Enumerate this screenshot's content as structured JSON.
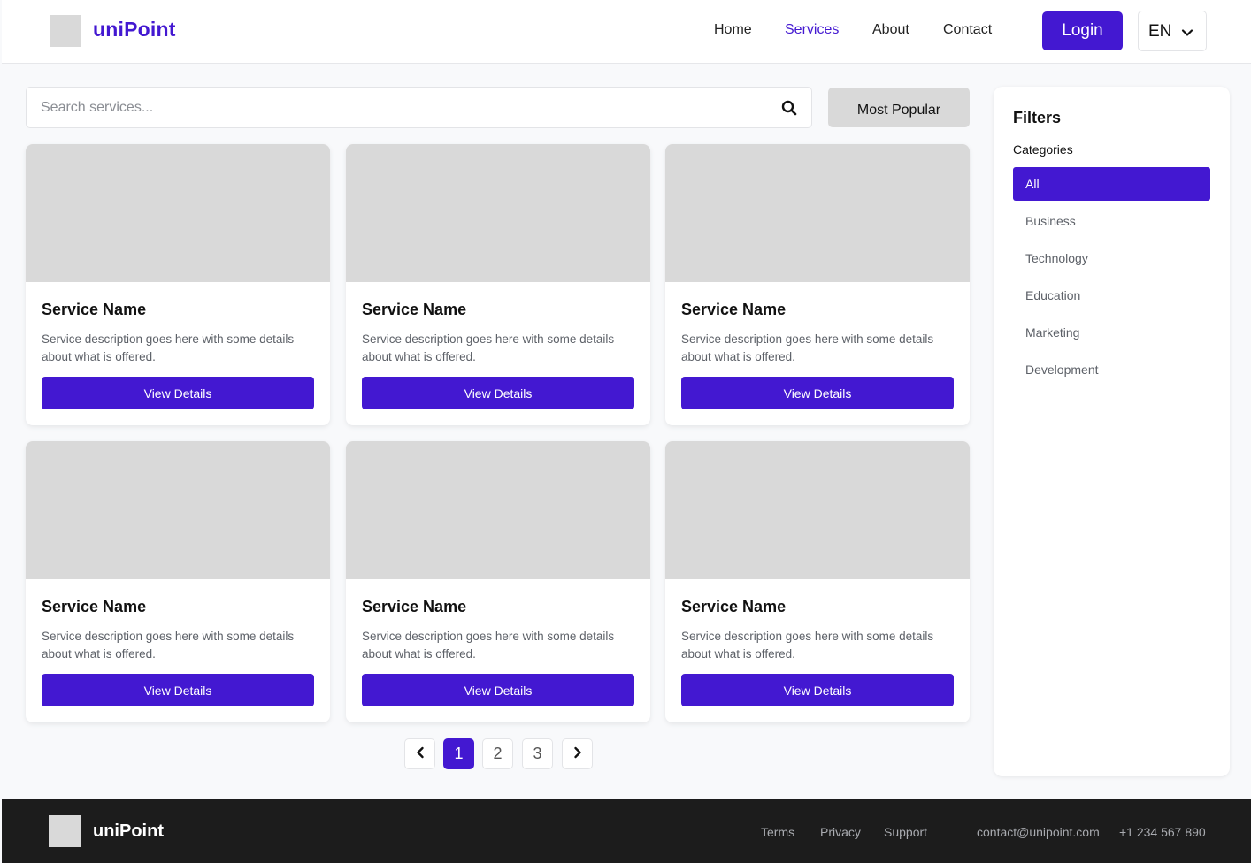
{
  "brand": {
    "name": "uniPoint",
    "accent": "#4318d1"
  },
  "header": {
    "nav": [
      "Home",
      "Services",
      "About",
      "Contact"
    ],
    "active_nav": "Services",
    "login_label": "Login",
    "language": "EN"
  },
  "search": {
    "placeholder": "Search services...",
    "value": ""
  },
  "sort": {
    "label": "Most Popular"
  },
  "cards": [
    {
      "title": "Service Name",
      "description": "Service description goes here with some details about what is offered.",
      "button": "View Details"
    },
    {
      "title": "Service Name",
      "description": "Service description goes here with some details about what is offered.",
      "button": "View Details"
    },
    {
      "title": "Service Name",
      "description": "Service description goes here with some details about what is offered.",
      "button": "View Details"
    },
    {
      "title": "Service Name",
      "description": "Service description goes here with some details about what is offered.",
      "button": "View Details"
    },
    {
      "title": "Service Name",
      "description": "Service description goes here with some details about what is offered.",
      "button": "View Details"
    },
    {
      "title": "Service Name",
      "description": "Service description goes here with some details about what is offered.",
      "button": "View Details"
    }
  ],
  "pagination": {
    "pages": [
      "1",
      "2",
      "3"
    ],
    "current": "1"
  },
  "filters": {
    "title": "Filters",
    "categories_label": "Categories",
    "categories": [
      "All",
      "Business",
      "Technology",
      "Education",
      "Marketing",
      "Development"
    ],
    "selected": "All"
  },
  "footer": {
    "brand": "uniPoint",
    "links": [
      "Terms",
      "Privacy",
      "Support"
    ],
    "email": "contact@unipoint.com",
    "phone": "+1 234 567 890"
  }
}
